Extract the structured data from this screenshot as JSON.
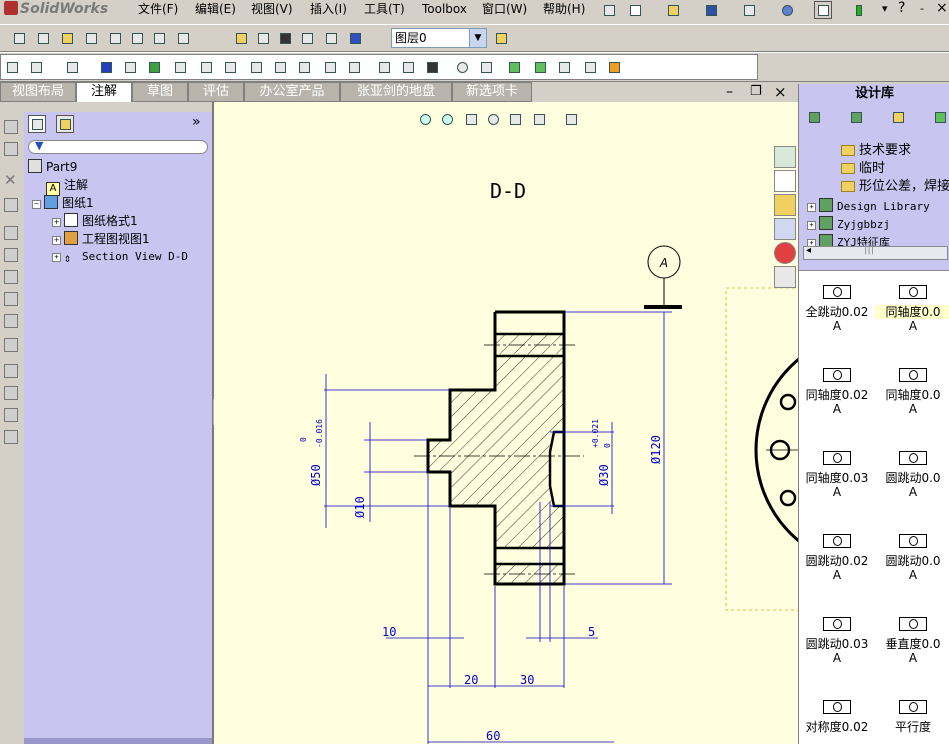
{
  "app": {
    "title": "SolidWorks"
  },
  "menu": [
    "文件(F)",
    "编辑(E)",
    "视图(V)",
    "插入(I)",
    "工具(T)",
    "Toolbox",
    "窗口(W)",
    "帮助(H)"
  ],
  "layer": {
    "value": "图层0"
  },
  "tabs": [
    {
      "label": "视图布局"
    },
    {
      "label": "注解"
    },
    {
      "label": "草图"
    },
    {
      "label": "评估"
    },
    {
      "label": "办公室产品"
    },
    {
      "label": "张亚剑的地盘"
    },
    {
      "label": "新选项卡"
    }
  ],
  "tree": {
    "root": "Part9",
    "items": [
      {
        "label": "注解"
      },
      {
        "label": "图纸1"
      },
      {
        "label": "图纸格式1"
      },
      {
        "label": "工程图视图1"
      },
      {
        "label": "Section View D-D"
      }
    ]
  },
  "drawing": {
    "section_title": "D-D",
    "datum_label": "A",
    "dims": {
      "d50": "Ø50",
      "d50_tol_upper": "0",
      "d50_tol_lower": "-0.016",
      "d10": "Ø10",
      "d30": "Ø30",
      "d30_tol_upper": "+0.021",
      "d30_tol_lower": "0",
      "d120": "Ø120",
      "l10": "10",
      "l5": "5",
      "l20": "20",
      "l30": "30",
      "l60": "60"
    }
  },
  "library": {
    "title": "设计库",
    "folders": [
      {
        "label": "技术要求"
      },
      {
        "label": "临时"
      },
      {
        "label": "形位公差，焊接"
      },
      {
        "label": "Design Library"
      },
      {
        "label": "Zyjgbbzj"
      },
      {
        "label": "ZYJ特征库"
      }
    ],
    "items": [
      {
        "label": "全跳动0.02",
        "datum": "A"
      },
      {
        "label": "同轴度0.0",
        "datum": "A"
      },
      {
        "label": "同轴度0.02",
        "datum": "A"
      },
      {
        "label": "同轴度0.0",
        "datum": "A"
      },
      {
        "label": "同轴度0.03",
        "datum": "A"
      },
      {
        "label": "圆跳动0.0",
        "datum": "A"
      },
      {
        "label": "圆跳动0.02",
        "datum": "A"
      },
      {
        "label": "圆跳动0.0",
        "datum": "A"
      },
      {
        "label": "圆跳动0.03",
        "datum": "A"
      },
      {
        "label": "垂直度0.0",
        "datum": "A"
      },
      {
        "label": "对称度0.02",
        "datum": ""
      },
      {
        "label": "平行度",
        "datum": ""
      }
    ]
  }
}
